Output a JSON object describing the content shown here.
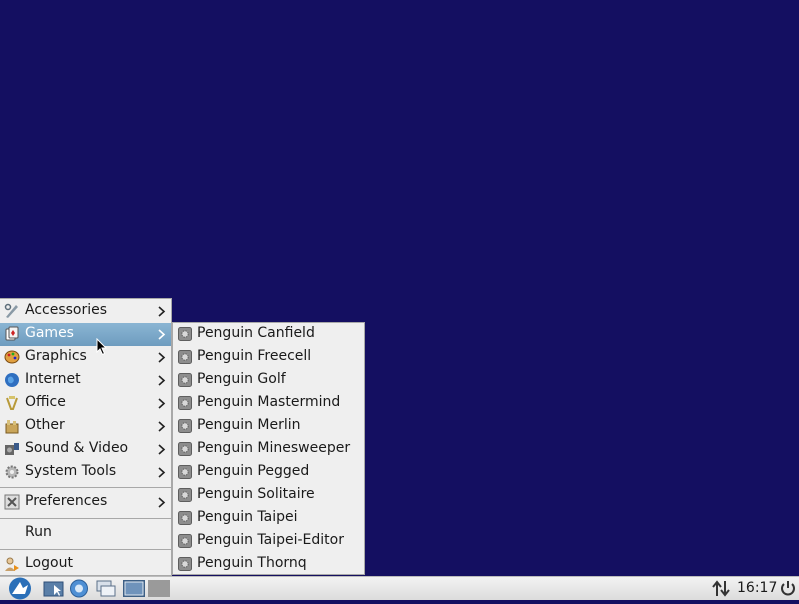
{
  "main_menu": {
    "items": [
      {
        "label": "Accessories",
        "icon": "accessories-icon"
      },
      {
        "label": "Games",
        "icon": "games-icon"
      },
      {
        "label": "Graphics",
        "icon": "graphics-icon"
      },
      {
        "label": "Internet",
        "icon": "internet-icon"
      },
      {
        "label": "Office",
        "icon": "office-icon"
      },
      {
        "label": "Other",
        "icon": "other-icon"
      },
      {
        "label": "Sound & Video",
        "icon": "sound-video-icon"
      },
      {
        "label": "System Tools",
        "icon": "system-tools-icon"
      }
    ],
    "preferences_label": "Preferences",
    "run_label": "Run",
    "logout_label": "Logout",
    "highlighted": "Games"
  },
  "games_submenu": {
    "items": [
      "Penguin Canfield",
      "Penguin Freecell",
      "Penguin Golf",
      "Penguin Mastermind",
      "Penguin Merlin",
      "Penguin Minesweeper",
      "Penguin Pegged",
      "Penguin Solitaire",
      "Penguin Taipei",
      "Penguin Taipei-Editor",
      "Penguin Thornq"
    ]
  },
  "taskbar": {
    "clock": "16:17"
  },
  "colors": {
    "desktop": "#140f61",
    "highlight": "#7ea9c9",
    "menu_bg": "#efefef"
  }
}
